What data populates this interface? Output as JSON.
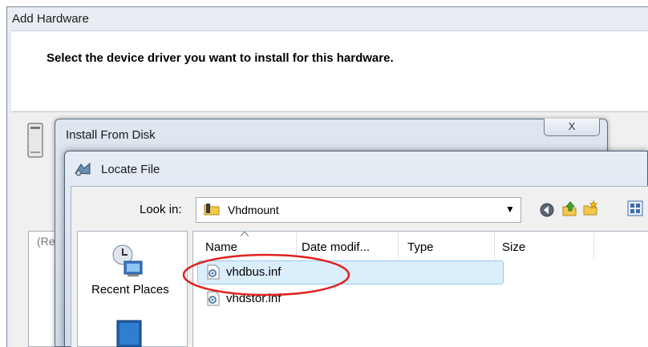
{
  "add_hardware": {
    "title": "Add Hardware",
    "instruction": "Select the device driver you want to install for this hardware.",
    "list_partial_text": "(Re"
  },
  "install_from_disk": {
    "title": "Install From Disk",
    "close_glyph": "X"
  },
  "locate_file": {
    "title": "Locate File",
    "look_in_label": "Look in:",
    "look_in_value": "Vhdmount",
    "places": [
      {
        "label": "Recent Places",
        "icon": "recent-places-icon"
      },
      {
        "label": "",
        "icon": "desktop-icon"
      }
    ],
    "columns": [
      "Name",
      "Date modif...",
      "Type",
      "Size"
    ],
    "files": [
      {
        "name": "vhdbus.inf",
        "icon": "inf-file-icon",
        "selected": true
      },
      {
        "name": "vhdstor.inf",
        "icon": "inf-file-icon",
        "selected": false
      }
    ],
    "toolbar": [
      "back-icon",
      "up-folder-icon",
      "new-folder-icon",
      "view-menu-icon"
    ]
  },
  "annotation": {
    "color": "#e0221f"
  }
}
